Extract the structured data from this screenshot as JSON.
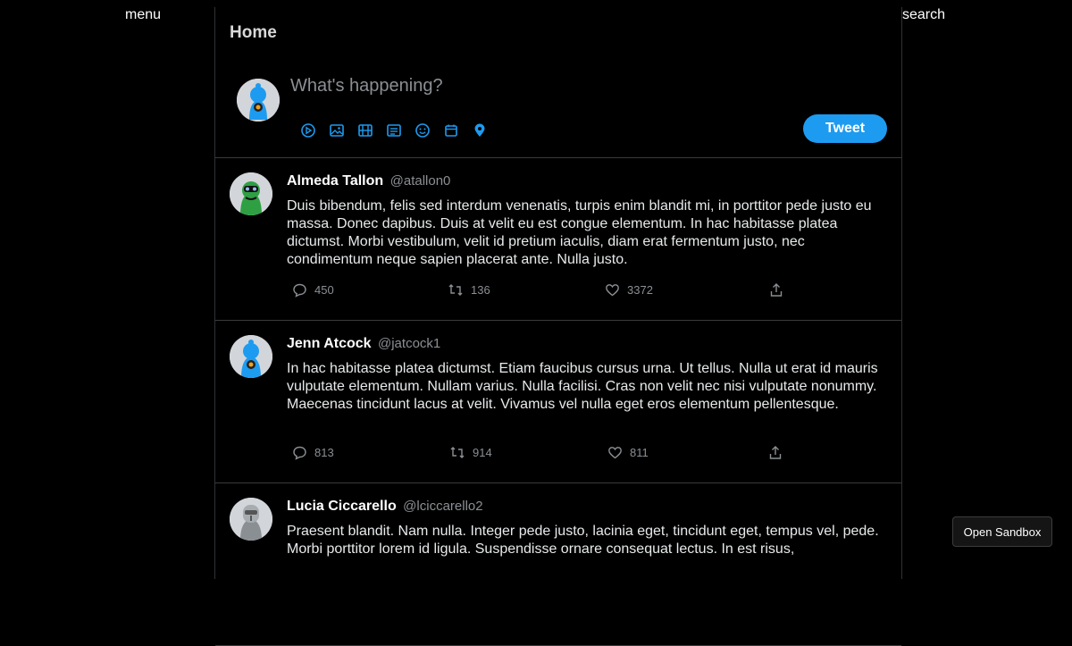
{
  "nav": {
    "menu_label": "menu",
    "search_label": "search"
  },
  "header": {
    "title": "Home"
  },
  "composer": {
    "placeholder": "What's happening?",
    "tweet_button": "Tweet",
    "toolbar_icons": [
      "gif-icon",
      "image-icon",
      "film-icon",
      "poll-icon",
      "emoji-icon",
      "schedule-icon",
      "location-icon"
    ]
  },
  "tweets": [
    {
      "name": "Almeda Tallon",
      "handle": "@atallon0",
      "text": "Duis bibendum, felis sed interdum venenatis, turpis enim blandit mi, in porttitor pede justo eu massa. Donec dapibus. Duis at velit eu est congue elementum. In hac habitasse platea dictumst. Morbi vestibulum, velit id pretium iaculis, diam erat fermentum justo, nec condimentum neque sapien placerat ante. Nulla justo.",
      "replies": "450",
      "retweets": "136",
      "likes": "3372",
      "avatar_color": "#2ea043"
    },
    {
      "name": "Jenn Atcock",
      "handle": "@jatcock1",
      "text": "In hac habitasse platea dictumst. Etiam faucibus cursus urna. Ut tellus. Nulla ut erat id mauris vulputate elementum. Nullam varius. Nulla facilisi. Cras non velit nec nisi vulputate nonummy. Maecenas tincidunt lacus at velit. Vivamus vel nulla eget eros elementum pellentesque.",
      "replies": "813",
      "retweets": "914",
      "likes": "811",
      "avatar_color": "#1d9bf0"
    },
    {
      "name": "Lucia Ciccarello",
      "handle": "@lciccarello2",
      "text": "Praesent blandit. Nam nulla. Integer pede justo, lacinia eget, tincidunt eget, tempus vel, pede. Morbi porttitor lorem id ligula. Suspendisse ornare consequat lectus. In est risus,",
      "replies": "",
      "retweets": "",
      "likes": "",
      "avatar_color": "#9aa0a6"
    }
  ],
  "sandbox": {
    "label": "Open Sandbox"
  },
  "colors": {
    "accent": "#1d9bf0",
    "background": "#000000",
    "muted": "#8b8f93"
  }
}
